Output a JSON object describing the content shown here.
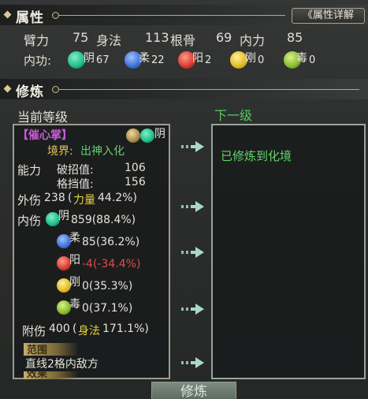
{
  "attributes_header": {
    "title": "属性",
    "detail_button": "《属性详解"
  },
  "attributes": {
    "bili_label": "臂力",
    "bili_value": "75",
    "shenfa_label": "身法",
    "shenfa_value": "113",
    "gengu_label": "根骨",
    "gengu_value": "69",
    "neili_label": "内力",
    "neili_value": "85"
  },
  "neigong": {
    "label": "内功:",
    "items": [
      {
        "name": "阴",
        "value": "67",
        "color": "#1fb98a"
      },
      {
        "name": "柔",
        "value": "22",
        "color": "#3d6fd6"
      },
      {
        "name": "阳",
        "value": "2",
        "color": "#d63a2e"
      },
      {
        "name": "刚",
        "value": "0",
        "color": "#e0b923"
      },
      {
        "name": "毒",
        "value": "0",
        "color": "#86b92c"
      }
    ]
  },
  "cultivation_header": {
    "title": "修炼"
  },
  "current_level_title": "当前等级",
  "next_level_title": "下一级",
  "skill": {
    "name": "【催心掌】",
    "type": "阴",
    "realm_label": "境界:",
    "realm_value": "出神入化",
    "ability_label": "能力",
    "break_label": "破招值:",
    "break_value": "106",
    "block_label": "格挡值:",
    "block_value": "156",
    "external_label": "外伤",
    "external_value": "238",
    "external_bonus_open": "(",
    "external_bonus_attr": "力量",
    "external_bonus_value": "44.2%)",
    "internal_label": "内伤",
    "internal_items": [
      {
        "name": "阴",
        "value": "859(88.4%)",
        "color": "#1fb98a",
        "text_color": "#e6e3da"
      },
      {
        "name": "柔",
        "value": "85(36.2%)",
        "color": "#3d6fd6",
        "text_color": "#e6e3da"
      },
      {
        "name": "阳",
        "value": "-4(-34.4%)",
        "color": "#d63a2e",
        "text_color": "#e04a4a"
      },
      {
        "name": "刚",
        "value": "0(35.3%)",
        "color": "#e0b923",
        "text_color": "#e6e3da"
      },
      {
        "name": "毒",
        "value": "0(37.1%)",
        "color": "#86b92c",
        "text_color": "#e6e3da"
      }
    ],
    "attached_label": "附伤",
    "attached_value": "400",
    "attached_bonus_open": "(",
    "attached_bonus_attr": "身法",
    "attached_bonus_value": "171.1%)",
    "range_label": "范围",
    "range_value": "直线2格内敌方",
    "effect_label": "效果"
  },
  "next_level_text": "已修炼到化境",
  "cultivate_button": "修炼"
}
